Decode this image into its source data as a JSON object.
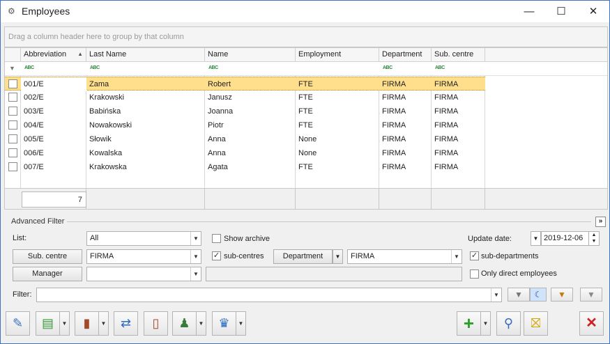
{
  "window": {
    "title": "Employees",
    "minimize": "—",
    "maximize": "☐",
    "close": "✕"
  },
  "group_panel": {
    "hint": "Drag a column header here to group by that column"
  },
  "grid": {
    "columns": [
      "Abbreviation",
      "Last Name",
      "Name",
      "Employment",
      "Department",
      "Sub. centre"
    ],
    "sort_indicator": "▲",
    "filter_icon": "ABC",
    "rows": [
      {
        "abbr": "001/E",
        "last": "Zama",
        "name": "Robert",
        "emp": "FTE",
        "dept": "FIRMA",
        "sub": "FIRMA",
        "selected": true
      },
      {
        "abbr": "002/E",
        "last": "Krakowski",
        "name": "Janusz",
        "emp": "FTE",
        "dept": "FIRMA",
        "sub": "FIRMA"
      },
      {
        "abbr": "003/E",
        "last": "Babińska",
        "name": "Joanna",
        "emp": "FTE",
        "dept": "FIRMA",
        "sub": "FIRMA"
      },
      {
        "abbr": "004/E",
        "last": "Nowakowski",
        "name": "Piotr",
        "emp": "FTE",
        "dept": "FIRMA",
        "sub": "FIRMA"
      },
      {
        "abbr": "005/E",
        "last": "Słowik",
        "name": "Anna",
        "emp": "None",
        "dept": "FIRMA",
        "sub": "FIRMA"
      },
      {
        "abbr": "006/E",
        "last": "Kowalska",
        "name": "Anna",
        "emp": "None",
        "dept": "FIRMA",
        "sub": "FIRMA"
      },
      {
        "abbr": "007/E",
        "last": "Krakowska",
        "name": "Agata",
        "emp": "FTE",
        "dept": "FIRMA",
        "sub": "FIRMA"
      }
    ],
    "count": "7"
  },
  "advanced_filter": {
    "title": "Advanced Filter",
    "collapse_icon": "»",
    "list_label": "List:",
    "list_value": "All",
    "show_archive": "Show archive",
    "update_date_label": "Update date:",
    "update_date": "2019-12-06",
    "sub_centre_button": "Sub. centre",
    "sub_centre_value": "FIRMA",
    "sub_centres": "sub-centres",
    "department_button": "Department",
    "department_value": "FIRMA",
    "sub_departments": "sub-departments",
    "manager_button": "Manager",
    "manager_value": "",
    "only_direct": "Only direct employees",
    "filter_label": "Filter:",
    "filter_value": ""
  },
  "toolbar": {
    "add": "+",
    "close": "✕"
  },
  "colors": {
    "selection": "#ffdf8c",
    "accent": "#3c73c4"
  }
}
